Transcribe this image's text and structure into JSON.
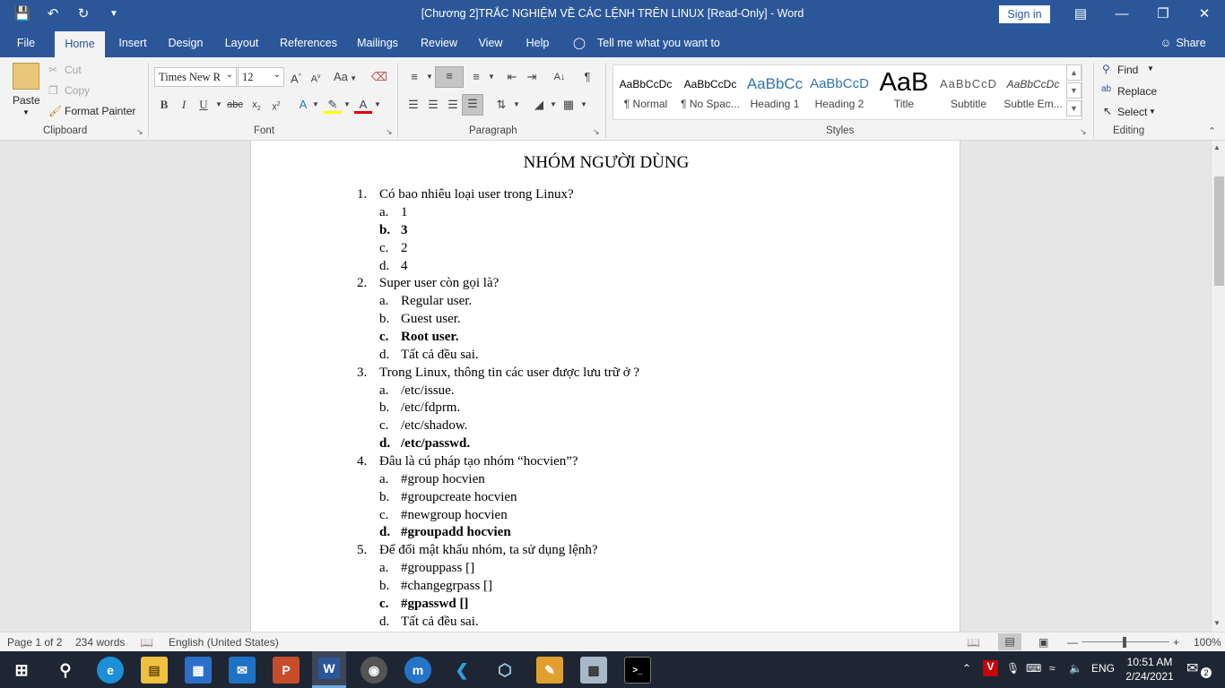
{
  "window": {
    "title": "[Chương 2]TRẮC NGHIỆM VỀ CÁC LỆNH TRÊN LINUX [Read-Only]  -  Word",
    "signin": "Sign in"
  },
  "tabs": [
    "File",
    "Home",
    "Insert",
    "Design",
    "Layout",
    "References",
    "Mailings",
    "Review",
    "View",
    "Help"
  ],
  "tell_me": "Tell me what you want to do",
  "share": "Share",
  "clipboard": {
    "paste": "Paste",
    "cut": "Cut",
    "copy": "Copy",
    "format_painter": "Format Painter",
    "label": "Clipboard"
  },
  "font": {
    "name": "Times New R",
    "size": "12",
    "label": "Font",
    "change_case": "Aa"
  },
  "paragraph": {
    "label": "Paragraph"
  },
  "styles": {
    "label": "Styles",
    "items": [
      {
        "preview": "AaBbCcDc",
        "name": "¶ Normal"
      },
      {
        "preview": "AaBbCcDc",
        "name": "¶ No Spac..."
      },
      {
        "preview": "AaBbCc",
        "name": "Heading 1"
      },
      {
        "preview": "AaBbCcD",
        "name": "Heading 2"
      },
      {
        "preview": "AaB",
        "name": "Title"
      },
      {
        "preview": "AaBbCcD",
        "name": "Subtitle"
      },
      {
        "preview": "AaBbCcDc",
        "name": "Subtle Em..."
      }
    ]
  },
  "editing": {
    "find": "Find",
    "replace": "Replace",
    "select": "Select",
    "label": "Editing"
  },
  "document": {
    "heading": "NHÓM NGƯỜI DÙNG",
    "questions": [
      {
        "num": "1.",
        "text": "Có bao nhiêu loại user trong Linux?",
        "answers": [
          {
            "l": "a.",
            "t": "1"
          },
          {
            "l": "b.",
            "t": "3"
          },
          {
            "l": "c.",
            "t": "2"
          },
          {
            "l": "d.",
            "t": "4"
          }
        ]
      },
      {
        "num": "2.",
        "text": "Super user còn gọi là?",
        "answers": [
          {
            "l": "a.",
            "t": "Regular user."
          },
          {
            "l": "b.",
            "t": "Guest user."
          },
          {
            "l": "c.",
            "t": "Root user."
          },
          {
            "l": "d.",
            "t": "Tất cả đều sai."
          }
        ]
      },
      {
        "num": "3.",
        "text": "Trong Linux, thông tin các user được lưu trữ ở ?",
        "answers": [
          {
            "l": "a.",
            "t": "/etc/issue."
          },
          {
            "l": "b.",
            "t": "/etc/fdprm."
          },
          {
            "l": "c.",
            "t": "/etc/shadow."
          },
          {
            "l": "d.",
            "t": "/etc/passwd."
          }
        ]
      },
      {
        "num": "4.",
        "text": "Đâu là cú pháp tạo nhóm “hocvien”?",
        "answers": [
          {
            "l": "a.",
            "t": "#group hocvien"
          },
          {
            "l": "b.",
            "t": "#groupcreate hocvien"
          },
          {
            "l": "c.",
            "t": "#newgroup hocvien"
          },
          {
            "l": "d.",
            "t": "#groupadd  hocvien"
          }
        ]
      },
      {
        "num": "5.",
        "text": "Để đổi mật khẩu nhóm, ta sử dụng lệnh?",
        "answers": [
          {
            "l": "a.",
            "t": "#grouppass []"
          },
          {
            "l": "b.",
            "t": "#changegrpass []"
          },
          {
            "l": "c.",
            "t": "#gpasswd []"
          },
          {
            "l": "d.",
            "t": "Tất cả đều sai."
          }
        ]
      }
    ]
  },
  "status": {
    "page": "Page 1 of 2",
    "words": "234 words",
    "language": "English (United States)",
    "zoom": "100%"
  },
  "taskbar": {
    "lang": "ENG",
    "time": "10:51 AM",
    "date": "2/24/2021",
    "notifications": "2"
  }
}
